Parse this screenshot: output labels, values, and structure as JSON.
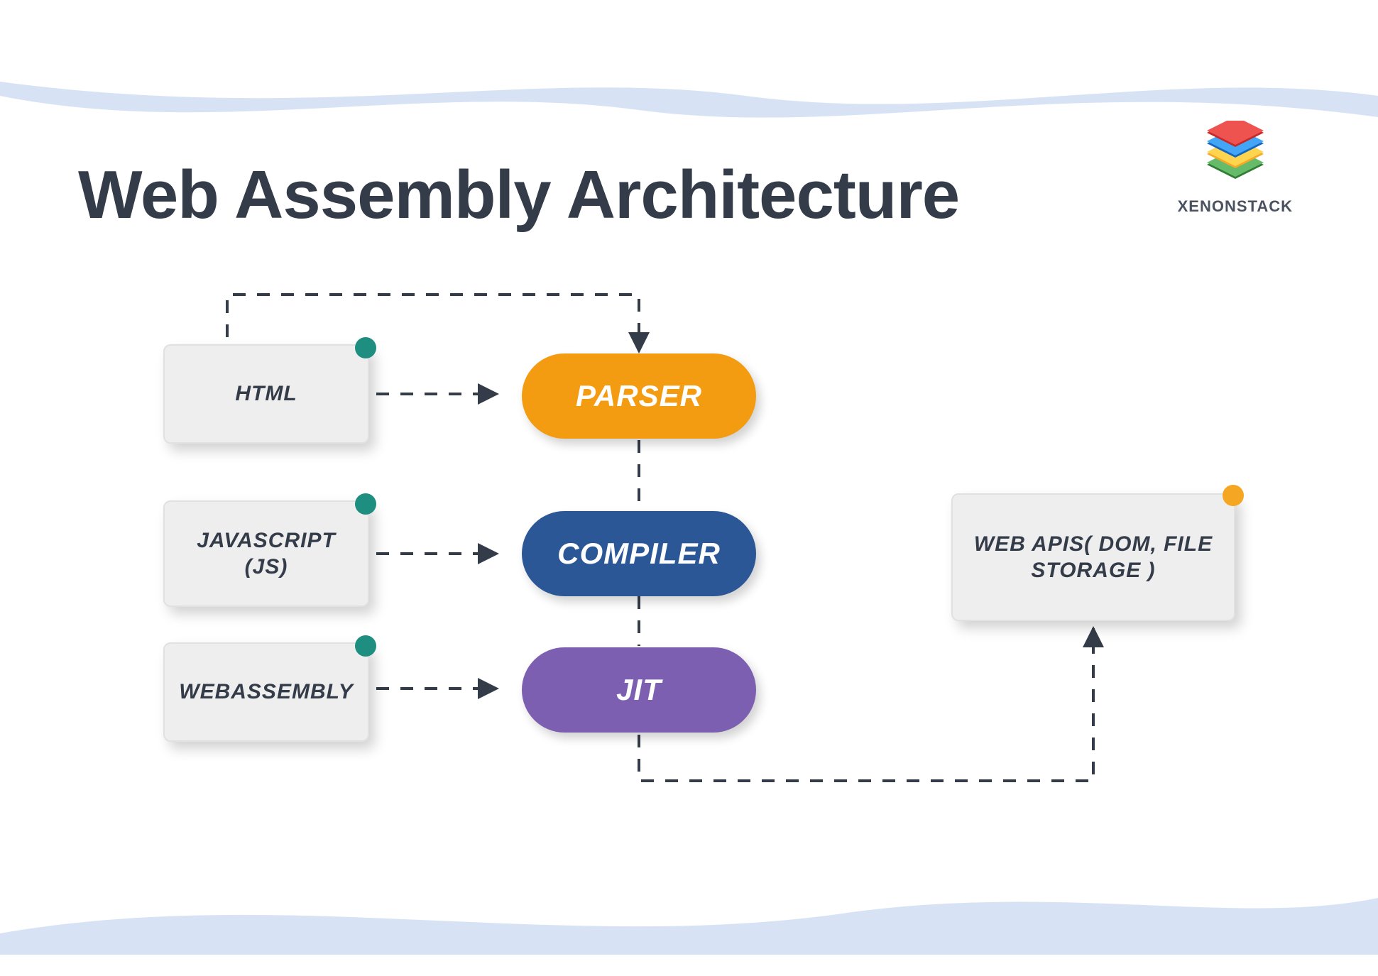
{
  "title": "Web Assembly Architecture",
  "brand": "XENONSTACK",
  "nodes": {
    "html": "HTML",
    "javascript": "JAVASCRIPT (JS)",
    "webassembly": "WEBASSEMBLY",
    "parser": "PARSER",
    "compiler": "COMPILER",
    "jit": "JIT",
    "webapis": "WEB APIS( DOM, FILE STORAGE )"
  },
  "colors": {
    "title": "#343C49",
    "waves": "#D7E3F4",
    "greybox_bg": "#EEEEEE",
    "greybox_border": "#E1E1E1",
    "teal_dot": "#1E8E80",
    "orange_dot": "#F5A623",
    "pill_orange": "#F39C12",
    "pill_blue": "#2B5797",
    "pill_purple": "#7D5FB2",
    "connector": "#343C49"
  },
  "edges": [
    {
      "from": "html",
      "to": "parser",
      "style": "dashed-arrow"
    },
    {
      "from": "javascript",
      "to": "compiler",
      "style": "dashed-arrow"
    },
    {
      "from": "webassembly",
      "to": "jit",
      "style": "dashed-arrow"
    },
    {
      "from": "html_top",
      "to": "parser_top",
      "style": "dashed-arrow-elbow"
    },
    {
      "from": "parser",
      "to": "compiler",
      "style": "dashed"
    },
    {
      "from": "compiler",
      "to": "jit",
      "style": "dashed"
    },
    {
      "from": "jit_bottom",
      "to": "webapis_bottom",
      "style": "dashed-arrow-elbow"
    }
  ]
}
